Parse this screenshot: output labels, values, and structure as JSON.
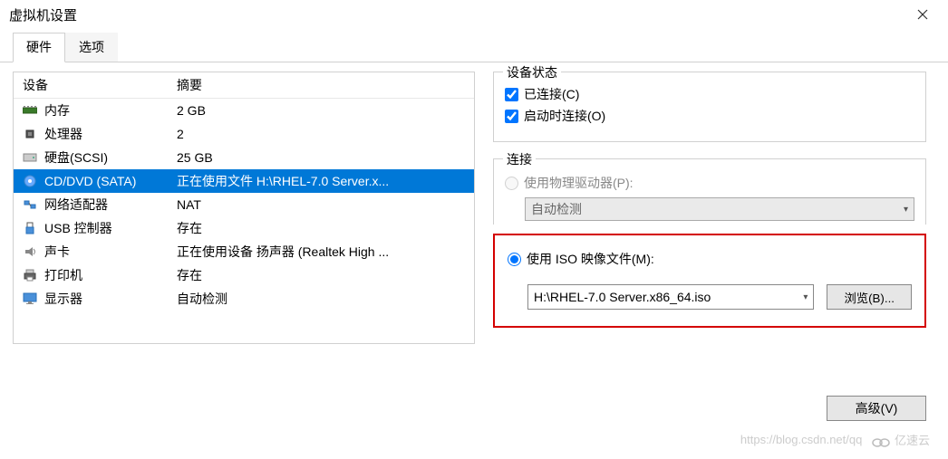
{
  "window": {
    "title": "虚拟机设置"
  },
  "tabs": {
    "hardware": "硬件",
    "options": "选项"
  },
  "columns": {
    "device": "设备",
    "summary": "摘要"
  },
  "devices": [
    {
      "name": "内存",
      "summary": "2 GB",
      "icon": "memory"
    },
    {
      "name": "处理器",
      "summary": "2",
      "icon": "cpu"
    },
    {
      "name": "硬盘(SCSI)",
      "summary": "25 GB",
      "icon": "hdd"
    },
    {
      "name": "CD/DVD (SATA)",
      "summary": "正在使用文件 H:\\RHEL-7.0 Server.x...",
      "icon": "cd",
      "selected": true
    },
    {
      "name": "网络适配器",
      "summary": "NAT",
      "icon": "net"
    },
    {
      "name": "USB 控制器",
      "summary": "存在",
      "icon": "usb"
    },
    {
      "name": "声卡",
      "summary": "正在使用设备 扬声器 (Realtek High ...",
      "icon": "sound"
    },
    {
      "name": "打印机",
      "summary": "存在",
      "icon": "printer"
    },
    {
      "name": "显示器",
      "summary": "自动检测",
      "icon": "display"
    }
  ],
  "status": {
    "legend": "设备状态",
    "connected_label": "已连接(C)",
    "connected_checked": true,
    "connect_at_power_label": "启动时连接(O)",
    "connect_at_power_checked": true
  },
  "connection": {
    "legend": "连接",
    "physical_label": "使用物理驱动器(P):",
    "physical_value": "自动检测",
    "iso_label": "使用 ISO 映像文件(M):",
    "iso_value": "H:\\RHEL-7.0 Server.x86_64.iso",
    "browse_label": "浏览(B)...",
    "selected": "iso"
  },
  "advanced_button": "高级(V)",
  "watermark": {
    "url": "https://blog.csdn.net/qq",
    "brand": "亿速云"
  }
}
